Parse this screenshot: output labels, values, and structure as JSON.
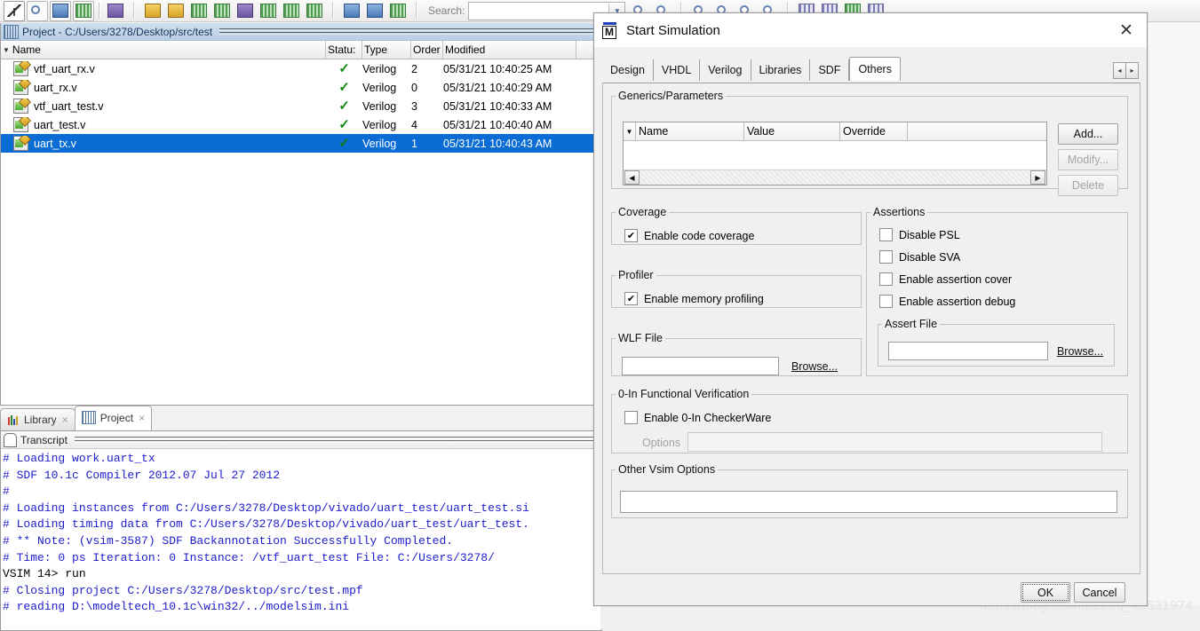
{
  "toolbar": {
    "search_label": "Search:",
    "search_value": "",
    "icons": [
      "select-arrow-icon",
      "zoom-select-icon",
      "pan-icon",
      "grid-select-icon",
      "traffic-signal-icon",
      "compile-icon",
      "compile-all-icon",
      "simulate-icon",
      "simulate-down-icon",
      "step-icon",
      "step-into-icon",
      "step-over-icon",
      "step-out-icon",
      "run-icon",
      "run-continue-icon",
      "restart-icon",
      "find-icon",
      "find-next-icon",
      "zoom-in-icon",
      "zoom-out-icon",
      "zoom-full-icon",
      "zoom-range-icon",
      "wave-icon",
      "wave-group-icon",
      "cursor-icon",
      "signal-icon"
    ]
  },
  "project_panel": {
    "title": "Project - C:/Users/3278/Desktop/src/test",
    "icon": "project-icon",
    "columns": [
      "Name",
      "Statu:",
      "Type",
      "Order",
      "Modified",
      ""
    ],
    "sort_column": "Name",
    "rows": [
      {
        "name": "vtf_uart_rx.v",
        "status": "check",
        "type": "Verilog",
        "order": "2",
        "modified": "05/31/21 10:40:25 AM",
        "selected": false
      },
      {
        "name": "uart_rx.v",
        "status": "check",
        "type": "Verilog",
        "order": "0",
        "modified": "05/31/21 10:40:29 AM",
        "selected": false
      },
      {
        "name": "vtf_uart_test.v",
        "status": "check",
        "type": "Verilog",
        "order": "3",
        "modified": "05/31/21 10:40:33 AM",
        "selected": false
      },
      {
        "name": "uart_test.v",
        "status": "check",
        "type": "Verilog",
        "order": "4",
        "modified": "05/31/21 10:40:40 AM",
        "selected": false
      },
      {
        "name": "uart_tx.v",
        "status": "check",
        "type": "Verilog",
        "order": "1",
        "modified": "05/31/21 10:40:43 AM",
        "selected": true
      }
    ],
    "selection_color": "#0a6cd4"
  },
  "bottom_tabs": [
    {
      "label": "Library",
      "icon": "library-icon",
      "active": false,
      "close": "×"
    },
    {
      "label": "Project",
      "icon": "project-icon",
      "active": true,
      "close": "×"
    }
  ],
  "transcript": {
    "title": "Transcript",
    "icon": "transcript-icon",
    "text_color": "#1c1ccc",
    "lines": [
      {
        "text": "# Loading work.uart_tx",
        "kind": "out"
      },
      {
        "text": "# SDF 10.1c Compiler 2012.07 Jul 27 2012",
        "kind": "out"
      },
      {
        "text": "#",
        "kind": "out"
      },
      {
        "text": "# Loading instances from C:/Users/3278/Desktop/vivado/uart_test/uart_test.si",
        "kind": "out"
      },
      {
        "text": "# Loading timing data from C:/Users/3278/Desktop/vivado/uart_test/uart_test.",
        "kind": "out"
      },
      {
        "text": "# ** Note: (vsim-3587) SDF Backannotation Successfully Completed.",
        "kind": "out"
      },
      {
        "text": "#     Time: 0 ps  Iteration: 0  Instance: /vtf_uart_test File: C:/Users/3278/",
        "kind": "out"
      },
      {
        "text": "VSIM 14> run",
        "kind": "cmd"
      },
      {
        "text": "# Closing project C:/Users/3278/Desktop/src/test.mpf",
        "kind": "out"
      },
      {
        "text": "# reading D:\\modeltech_10.1c\\win32/../modelsim.ini",
        "kind": "out"
      }
    ]
  },
  "dialog": {
    "title": "Start Simulation",
    "logo": "modelsim-m-logo",
    "logo_letter": "M",
    "close_icon": "close-icon",
    "tabs": [
      {
        "label": "Design",
        "active": false
      },
      {
        "label": "VHDL",
        "active": false
      },
      {
        "label": "Verilog",
        "active": false
      },
      {
        "label": "Libraries",
        "active": false
      },
      {
        "label": "SDF",
        "active": false
      },
      {
        "label": "Others",
        "active": true
      }
    ],
    "tab_scroll_left": "◂",
    "tab_scroll_right": "▸",
    "generics": {
      "legend": "Generics/Parameters",
      "columns": [
        "Name",
        "Value",
        "Override",
        ""
      ],
      "rows": [],
      "buttons": [
        {
          "label": "Add...",
          "disabled": false
        },
        {
          "label": "Modify...",
          "disabled": true
        },
        {
          "label": "Delete",
          "disabled": true
        }
      ],
      "scroll_left": "◀",
      "scroll_right": "▶"
    },
    "coverage": {
      "legend": "Coverage",
      "checkbox": {
        "label": "Enable code coverage",
        "checked": true
      }
    },
    "profiler": {
      "legend": "Profiler",
      "checkbox": {
        "label": "Enable memory profiling",
        "checked": true
      }
    },
    "wlf": {
      "legend": "WLF File",
      "value": "",
      "browse_label": "Browse..."
    },
    "assertions": {
      "legend": "Assertions",
      "checkboxes": [
        {
          "label": "Disable PSL",
          "checked": false
        },
        {
          "label": "Disable SVA",
          "checked": false
        },
        {
          "label": "Enable assertion cover",
          "checked": false
        },
        {
          "label": "Enable assertion debug",
          "checked": false
        }
      ],
      "assert_file": {
        "legend": "Assert File",
        "value": "",
        "browse_label": "Browse..."
      }
    },
    "zero_in": {
      "legend": "0-In Functional Verification",
      "checkbox": {
        "label": "Enable 0-In CheckerWare",
        "checked": false
      },
      "options_label": "Options",
      "options_value": "",
      "options_disabled": true
    },
    "other_vsim": {
      "legend": "Other Vsim Options",
      "value": ""
    },
    "footer": [
      {
        "label": "OK",
        "focused": true
      },
      {
        "label": "Cancel",
        "focused": false
      }
    ]
  },
  "watermark": "https://blog.csdn.net/qq_40531974"
}
